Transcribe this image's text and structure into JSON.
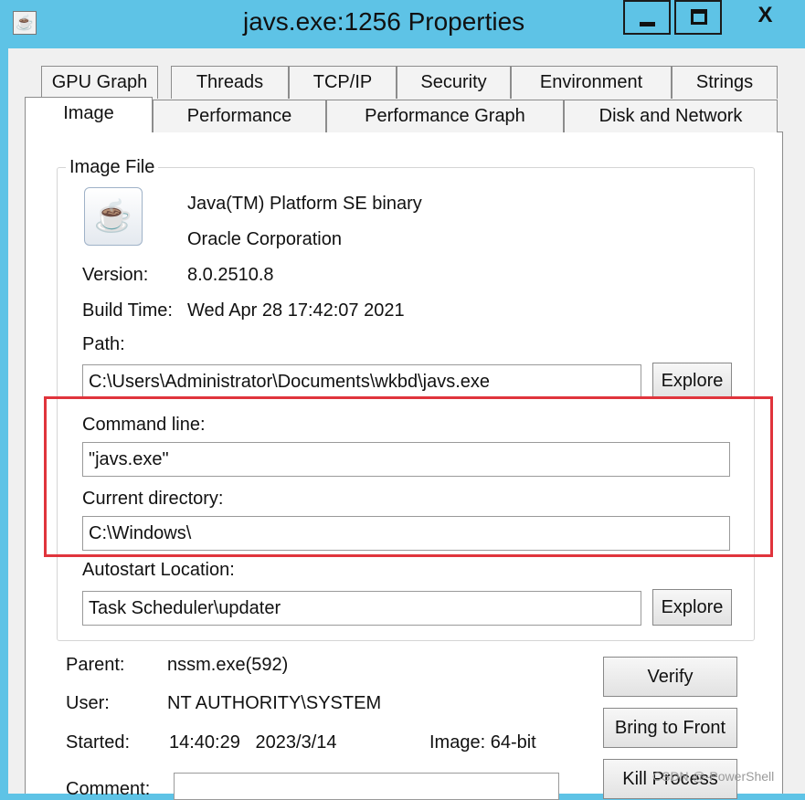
{
  "window": {
    "title": "javs.exe:1256 Properties",
    "close_glyph": "X"
  },
  "tabs": {
    "row1": [
      "GPU Graph",
      "Threads",
      "TCP/IP",
      "Security",
      "Environment",
      "Strings"
    ],
    "row2": [
      "Image",
      "Performance",
      "Performance Graph",
      "Disk and Network"
    ],
    "active": "Image"
  },
  "image_file": {
    "legend": "Image File",
    "description": "Java(TM) Platform SE binary",
    "company": "Oracle Corporation",
    "version_label": "Version:",
    "version": "8.0.2510.8",
    "build_label": "Build Time:",
    "build_time": "Wed Apr 28 17:42:07 2021",
    "path_label": "Path:",
    "path": "C:\\Users\\Administrator\\Documents\\wkbd\\javs.exe",
    "explore_label": "Explore",
    "cmdline_label": "Command line:",
    "cmdline": "\"javs.exe\"",
    "curdir_label": "Current directory:",
    "curdir": "C:\\Windows\\",
    "autostart_label": "Autostart Location:",
    "autostart": "Task Scheduler\\updater",
    "autostart_explore_label": "Explore"
  },
  "process": {
    "parent_label": "Parent:",
    "parent": "nssm.exe(592)",
    "user_label": "User:",
    "user": "NT AUTHORITY\\SYSTEM",
    "started_label": "Started:",
    "started": "14:40:29   2023/3/14",
    "image_bits": "Image: 64-bit",
    "comment_label": "Comment:"
  },
  "buttons": {
    "verify": "Verify",
    "bring_to_front": "Bring to Front",
    "kill_process": "Kill Process"
  },
  "watermark": "CSDN @-PowerShell",
  "colors": {
    "titlebar": "#5ec3e6",
    "highlight": "#e0343c"
  },
  "icons": {
    "app": "java-cup-icon",
    "file": "java-cup-icon"
  }
}
